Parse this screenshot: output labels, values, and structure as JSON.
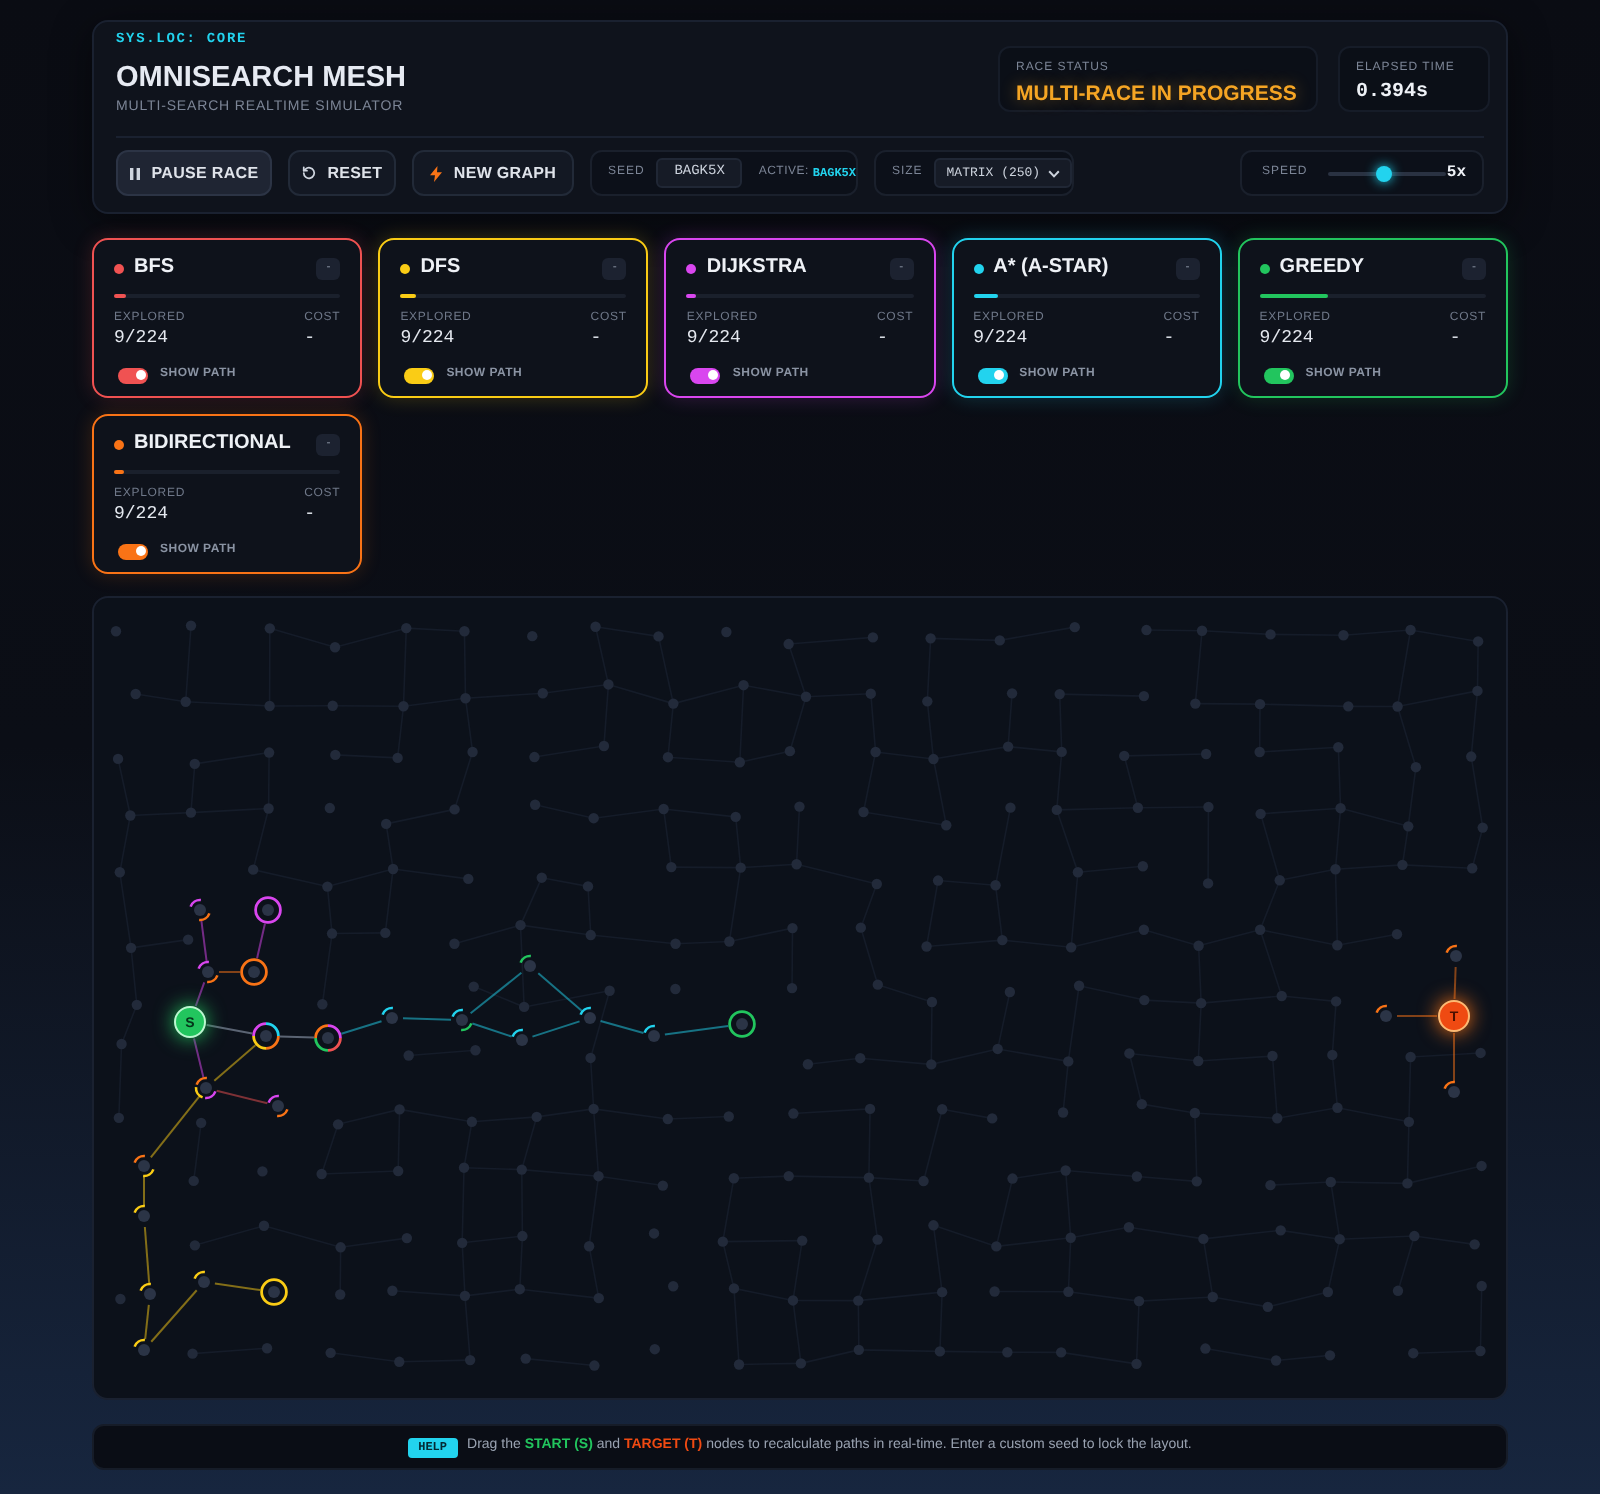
{
  "header": {
    "tag": "SYS.LOC: CORE",
    "title": "OMNISEARCH MESH",
    "subtitle": "MULTI-SEARCH REALTIME SIMULATOR"
  },
  "status": [
    {
      "kind": "status",
      "label": "RACE STATUS",
      "value": "MULTI-RACE IN PROGRESS"
    },
    {
      "kind": "timer",
      "label": "ELAPSED TIME",
      "value": "0.394s"
    }
  ],
  "controls": {
    "buttons": [
      {
        "kind": "pause",
        "label": "PAUSE RACE"
      },
      {
        "kind": "reset",
        "label": "RESET"
      },
      {
        "kind": "new",
        "label": "NEW GRAPH"
      }
    ],
    "seed": {
      "label": "SEED",
      "value": "BAGK5X",
      "active_label": "ACTIVE:",
      "active_value": "BAGK5X"
    },
    "size": {
      "label": "SIZE",
      "value": "MATRIX (250)"
    },
    "speed": {
      "label": "SPEED",
      "level": 0.47,
      "reading": "5x"
    }
  },
  "algorithms": [
    {
      "name": "BFS",
      "color": "#f05252",
      "rank": "-",
      "level": 0.05,
      "explored_label": "EXPLORED",
      "explored": "9/224",
      "cost_label": "COST",
      "cost": "-",
      "toggle_label": "SHOW PATH",
      "show_path": true
    },
    {
      "name": "DFS",
      "color": "#facc15",
      "rank": "-",
      "level": 0.07,
      "explored_label": "EXPLORED",
      "explored": "9/224",
      "cost_label": "COST",
      "cost": "-",
      "toggle_label": "SHOW PATH",
      "show_path": true
    },
    {
      "name": "DIJKSTRA",
      "color": "#d946ef",
      "rank": "-",
      "level": 0.045,
      "explored_label": "EXPLORED",
      "explored": "9/224",
      "cost_label": "COST",
      "cost": "-",
      "toggle_label": "SHOW PATH",
      "show_path": true
    },
    {
      "name": "A* (A-STAR)",
      "color": "#22d3ee",
      "rank": "-",
      "level": 0.11,
      "explored_label": "EXPLORED",
      "explored": "9/224",
      "cost_label": "COST",
      "cost": "-",
      "toggle_label": "SHOW PATH",
      "show_path": true
    },
    {
      "name": "GREEDY",
      "color": "#22c55e",
      "rank": "-",
      "level": 0.3,
      "explored_label": "EXPLORED",
      "explored": "9/224",
      "cost_label": "COST",
      "cost": "-",
      "toggle_label": "SHOW PATH",
      "show_path": true
    },
    {
      "name": "BIDIRECTIONAL",
      "color": "#f97316",
      "rank": "-",
      "level": 0.04,
      "explored_label": "EXPLORED",
      "explored": "9/224",
      "cost_label": "COST",
      "cost": "-",
      "toggle_label": "SHOW PATH",
      "show_path": true
    }
  ],
  "graph": {
    "start_label": "S",
    "target_label": "T"
  },
  "help": {
    "badge": "HELP",
    "text": "Drag the **START (S)** and **TARGET (T)** nodes to recalculate paths in real-time. Enter a custom seed to lock the layout."
  }
}
